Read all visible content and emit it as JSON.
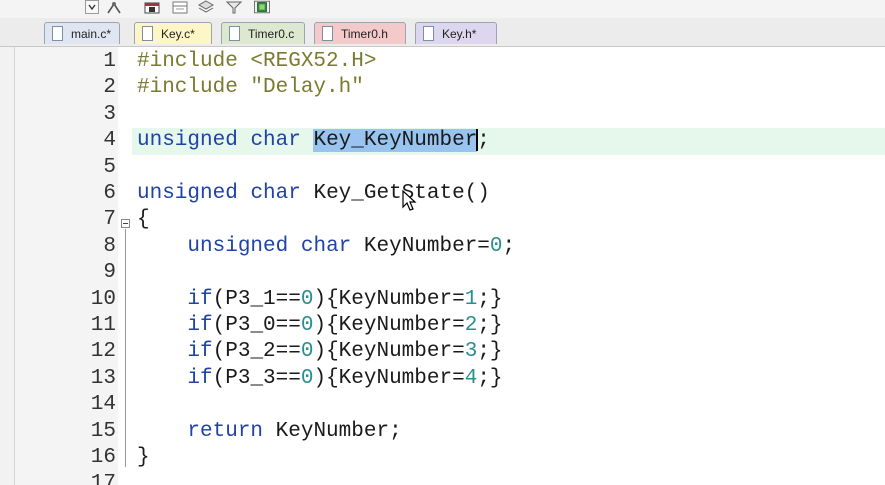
{
  "toolbar": {
    "icons": [
      "dropdown-icon",
      "build-icon",
      "sheet-icon",
      "window-icon",
      "layers-icon",
      "filter-icon",
      "chip-icon"
    ]
  },
  "tabs": [
    {
      "label": "main.c*",
      "color": "#dfe6f2",
      "active": false
    },
    {
      "label": "Key.c*",
      "color": "#fff6c8",
      "active": true
    },
    {
      "label": "Timer0.c",
      "color": "#dce9cf",
      "active": false
    },
    {
      "label": "Timer0.h",
      "color": "#f3c9c9",
      "active": false
    },
    {
      "label": "Key.h*",
      "color": "#dcd7ef",
      "active": false
    }
  ],
  "editor": {
    "highlight_line": 4,
    "selected_text": "Key_KeyNumber",
    "lines": [
      {
        "n": "1",
        "code": "#include <REGX52.H>"
      },
      {
        "n": "2",
        "code": "#include \"Delay.h\""
      },
      {
        "n": "3",
        "code": ""
      },
      {
        "n": "4",
        "code": "unsigned char Key_KeyNumber;"
      },
      {
        "n": "5",
        "code": ""
      },
      {
        "n": "6",
        "code": "unsigned char Key_GetState()"
      },
      {
        "n": "7",
        "code": "{"
      },
      {
        "n": "8",
        "code": "    unsigned char KeyNumber=0;"
      },
      {
        "n": "9",
        "code": ""
      },
      {
        "n": "10",
        "code": "    if(P3_1==0){KeyNumber=1;}"
      },
      {
        "n": "11",
        "code": "    if(P3_0==0){KeyNumber=2;}"
      },
      {
        "n": "12",
        "code": "    if(P3_2==0){KeyNumber=3;}"
      },
      {
        "n": "13",
        "code": "    if(P3_3==0){KeyNumber=4;}"
      },
      {
        "n": "14",
        "code": ""
      },
      {
        "n": "15",
        "code": "    return KeyNumber;"
      },
      {
        "n": "16",
        "code": "}"
      },
      {
        "n": "17",
        "code": ""
      }
    ]
  }
}
